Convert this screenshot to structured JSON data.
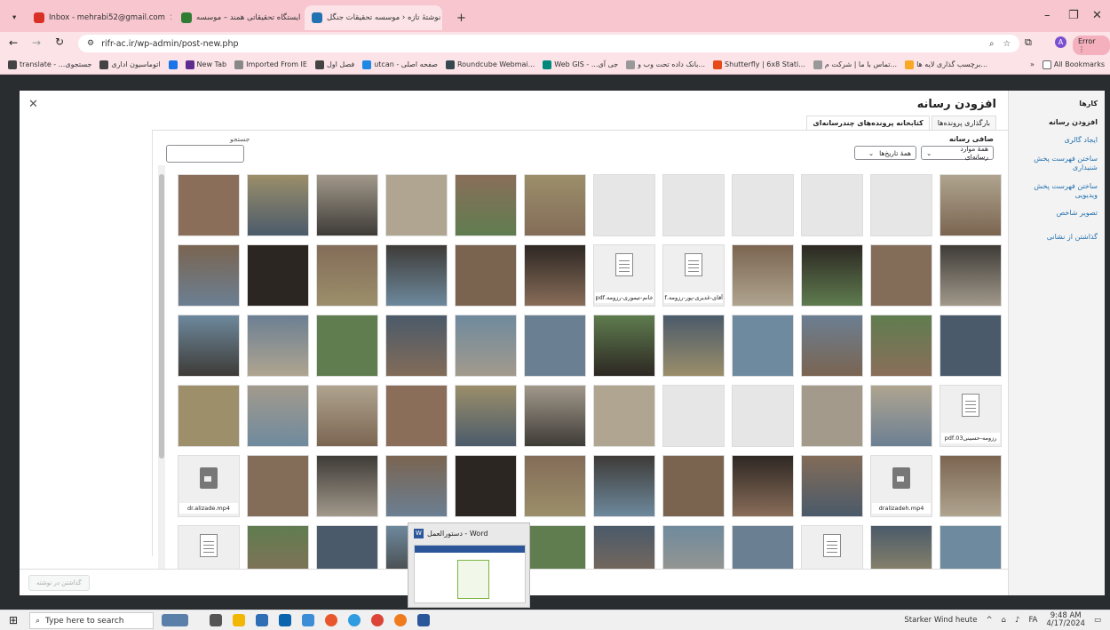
{
  "browser": {
    "tabs": [
      {
        "title": "Inbox - mehrabi52@gmail.com",
        "color": "#d93025",
        "active": false
      },
      {
        "title": "ایستگاه تحقیقاتی همند – موسسه",
        "color": "#2e7d32",
        "active": false
      },
      {
        "title": "نوشتهٔ تازه ‹ موسسه تحقیقات جنگل",
        "color": "#2271b1",
        "active": true
      }
    ],
    "new_tab": "+",
    "url": "rifr-ac.ir/wp-admin/post-new.php",
    "profile_status": "Error",
    "bookmarks": [
      {
        "label": "translate - ...جستجوی",
        "color": "#4285f4"
      },
      {
        "label": "اتوماسیون اداری",
        "color": "#444"
      },
      {
        "label": "",
        "color": "#1a73e8"
      },
      {
        "label": "New Tab",
        "color": "#5c2d91"
      },
      {
        "label": "Imported From IE",
        "color": "#888"
      },
      {
        "label": "فصل اول",
        "color": "#444"
      },
      {
        "label": "utcan - صفحه اصلی",
        "color": "#1e88e5"
      },
      {
        "label": "Roundcube Webmai...",
        "color": "#37474f"
      },
      {
        "label": "Web GIS - ...جی آی",
        "color": "#00897b"
      },
      {
        "label": "بانک داده تحت وب و...",
        "color": "#999"
      },
      {
        "label": "Shutterfly | 6x8 Stati...",
        "color": "#e64a19"
      },
      {
        "label": "تماس با ما | شرکت م...",
        "color": "#999"
      },
      {
        "label": "برچسب گذاری لایه ها...",
        "color": "#f9a825"
      }
    ],
    "all_bookmarks": "All Bookmarks"
  },
  "modal": {
    "title": "افزودن رسانه",
    "tabs": [
      "بارگذاری پرونده‌ها",
      "کتابخانه پرونده‌های چندرسانه‌ای"
    ],
    "filter_label": "صافی رسانه",
    "filter_type": "همهٔ موارد رسانه‌ای",
    "filter_date": "همهٔ تاریخ‌ها",
    "search_label": "جستجو",
    "insert_button": "گذاشتن در نوشته",
    "router": {
      "heading": "کارها",
      "items": [
        "افزودن رسانه",
        "ایجاد گالری",
        "ساختن فهرست پخش شنیداری",
        "ساختن فهرست پخش ویدیویی",
        "تصویر شاخص",
        "گذاشتن از نشانی"
      ]
    },
    "files": {
      "pdf1": "خانم-تیموری-رزومه.pdf",
      "pdf2": "آقای-غدیری-پور-رزومه.pdf",
      "pdf3": "رزومه-حسینی03.pdf",
      "mp4a": "dr.alizade.mp4",
      "mp4b": "dralizadeh.mp4"
    }
  },
  "word_preview": {
    "title": "دستورالعمل - Word"
  },
  "taskbar": {
    "search_placeholder": "Type here to search",
    "weather": "Starker Wind heute",
    "lang": "FA",
    "time": "9:48 AM",
    "date": "4/17/2024"
  }
}
